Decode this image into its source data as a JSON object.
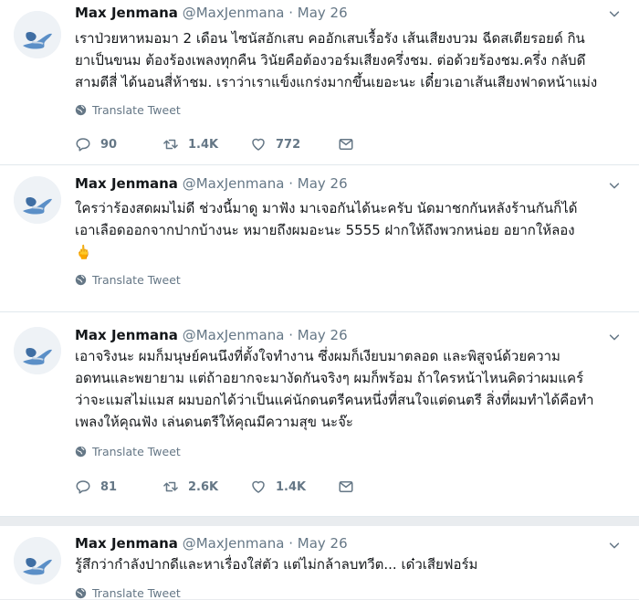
{
  "translate_label": "Translate Tweet",
  "tweets": [
    {
      "name": "Max Jenmana",
      "handle": "@MaxJenmana",
      "separator": "·",
      "date": "May 26",
      "lines": [
        "เราป่วยหาหมอมา 2 เดือน ไซนัสอักเสบ คออักเสบเรื้อรัง เส้นเสียงบวม ฉีดสเตียรอยด์ กิน",
        "ยาเป็นขนม ต้องร้องเพลงทุกคืน วินัยคือต้องวอร์มเสียงครึ่งชม. ต่อด้วยร้องชม.ครึ่ง กลับดึ",
        "สามตีสี่ ได้นอนสี่ห้าชม. เราว่าเราแข็งแกร่งมากขึ้นเยอะนะ เดี๋ยวเอาเส้นเสียงฟาดหน้าแม่ง"
      ],
      "replies": "90",
      "retweets": "1.4K",
      "likes": "772"
    },
    {
      "name": "Max Jenmana",
      "handle": "@MaxJenmana",
      "separator": "·",
      "date": "May 26",
      "lines": [
        "ใครว่าร้องสดผมไม่ดี ช่วงนี้มาดู มาฟัง มาเจอกันได้นะครับ นัดมาชกกันหลังร้านกันก็ได้",
        "เอาเลือดออกจากปากบ้างนะ หมายถึงผมอะนะ 5555 ฝากให้ถึงพวกหน่อย อยากให้ลอง"
      ],
      "emoji": "🖕"
    },
    {
      "name": "Max Jenmana",
      "handle": "@MaxJenmana",
      "separator": "·",
      "date": "May 26",
      "lines": [
        "เอาจริงนะ ผมก็มนุษย์คนนึงที่ตั้งใจทำงาน ซึ่งผมก็เงียบมาตลอด และพิสูจน์ด้วยความ",
        "อดทนและพยายาม แต่ถ้าอยากจะมางัดกันจริงๆ ผมก็พร้อม ถ้าใครหน้าไหนคิดว่าผมแคร์",
        "ว่าจะแมสไม่แมส ผมบอกได้ว่าเป็นแค่นักดนตรีคนหนึ่งที่สนใจแต่ดนตรี สิ่งที่ผมทำได้คือทำ",
        "เพลงให้คุณฟัง เล่นดนตรีให้คุณมีความสุข นะจ๊ะ"
      ],
      "replies": "81",
      "retweets": "2.6K",
      "likes": "1.4K"
    },
    {
      "name": "Max Jenmana",
      "handle": "@MaxJenmana",
      "separator": "·",
      "date": "May 26",
      "lines": [
        "รู้สึกว่ากำลังปากดีและหาเรื่องใส่ตัว แต่ไม่กล้าลบทวีต... เด๋วเสียฟอร์ม"
      ]
    }
  ]
}
